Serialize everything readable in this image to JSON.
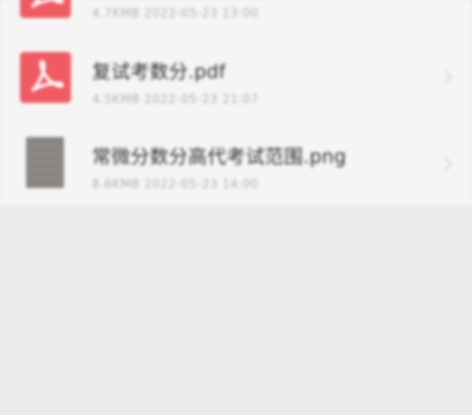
{
  "files": [
    {
      "type": "pdf",
      "icon": "pdf-icon",
      "name": "",
      "meta": "4.7KMB  2022-05-23  13:00"
    },
    {
      "type": "pdf",
      "icon": "pdf-icon",
      "name": "复试考数分.pdf",
      "meta": "4.5KMB  2022-05-23  21:07"
    },
    {
      "type": "image",
      "icon": "image-file-icon",
      "name": "常微分数分高代考试范围.png",
      "meta": "8.6KMB  2022-05-23  14:00"
    }
  ],
  "colors": {
    "pdf_red": "#f05b63",
    "list_background": "#f5f5f5",
    "page_background": "#eaebea",
    "title_text": "#2f3033",
    "meta_text": "#aeb0b3"
  }
}
